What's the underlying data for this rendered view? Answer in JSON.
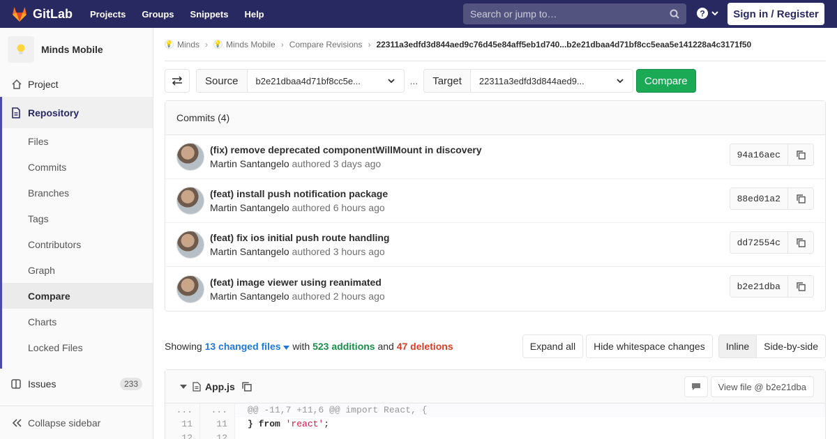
{
  "navbar": {
    "brand": "GitLab",
    "links": [
      "Projects",
      "Groups",
      "Snippets",
      "Help"
    ],
    "search_placeholder": "Search or jump to…",
    "signin": "Sign in / Register"
  },
  "sidebar": {
    "project_name": "Minds Mobile",
    "project": "Project",
    "repository": "Repository",
    "repo_items": [
      "Files",
      "Commits",
      "Branches",
      "Tags",
      "Contributors",
      "Graph",
      "Compare",
      "Charts",
      "Locked Files"
    ],
    "issues": "Issues",
    "issues_count": "233",
    "collapse": "Collapse sidebar"
  },
  "breadcrumb": {
    "items": [
      "Minds",
      "Minds Mobile",
      "Compare Revisions"
    ],
    "current": "22311a3edfd3d844aed9c76d45e84aff5eb1d740...b2e21dbaa4d71bf8cc5eaa5e141228a4c3171f50"
  },
  "compare": {
    "source_label": "Source",
    "source_value": "b2e21dbaa4d71bf8cc5e...",
    "dots": "...",
    "target_label": "Target",
    "target_value": "22311a3edfd3d844aed9...",
    "button": "Compare"
  },
  "commits": {
    "header": "Commits (4)",
    "authored": "authored",
    "items": [
      {
        "title": "(fix) remove deprecated componentWillMount in discovery",
        "author": "Martin Santangelo",
        "time": "3 days ago",
        "sha": "94a16aec"
      },
      {
        "title": "(feat) install push notification package",
        "author": "Martin Santangelo",
        "time": "6 hours ago",
        "sha": "88ed01a2"
      },
      {
        "title": "(feat) fix ios initial push route handling",
        "author": "Martin Santangelo",
        "time": "3 hours ago",
        "sha": "dd72554c"
      },
      {
        "title": "(feat) image viewer using reanimated",
        "author": "Martin Santangelo",
        "time": "2 hours ago",
        "sha": "b2e21dba"
      }
    ]
  },
  "stats": {
    "showing": "Showing",
    "changed_files": "13 changed files",
    "with": "with",
    "additions": "523 additions",
    "and": "and",
    "deletions": "47 deletions",
    "expand_all": "Expand all",
    "hide_whitespace": "Hide whitespace changes",
    "inline": "Inline",
    "side_by_side": "Side-by-side"
  },
  "file": {
    "name": "App.js",
    "view_file": "View file @ b2e21dba",
    "lines": [
      {
        "old": "...",
        "new": "...",
        "text": "@@ -11,7 +11,6 @@ import React, {"
      },
      {
        "old": "11",
        "new": "11",
        "kw": "} from ",
        "str": "'react'",
        "end": ";"
      },
      {
        "old": "12",
        "new": "12",
        "text": ""
      }
    ]
  },
  "colors": {
    "navbar": "#292961",
    "accent": "#4b4ba3",
    "compare_button": "#1aaa55",
    "additions": "#168f48",
    "deletions": "#db3b21",
    "link": "#1f78d1"
  }
}
